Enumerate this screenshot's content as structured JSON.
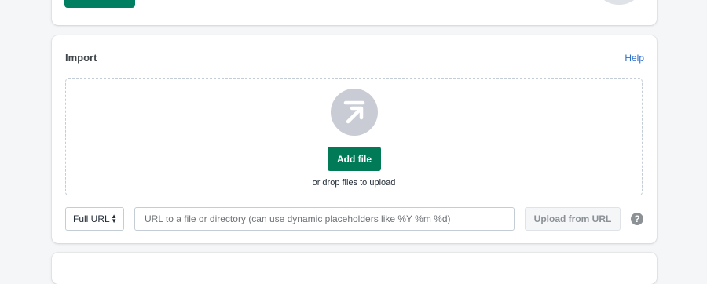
{
  "import": {
    "title": "Import",
    "help_link": "Help",
    "add_file_label": "Add file",
    "drop_hint": "or drop files to upload",
    "url_type_value": "Full URL",
    "url_input_placeholder": "URL to a file or directory (can use dynamic placeholders like %Y %m %d)",
    "upload_from_url_label": "Upload from URL",
    "help_icon_glyph": "?"
  },
  "colors": {
    "primary": "#008060",
    "link": "#2c6ecb",
    "upload_circle": "#c9ccd4"
  },
  "icons": {
    "upload": "upload-arrow-icon",
    "select_chevron": "chevron-up-down-icon",
    "help": "question-circle-icon"
  }
}
